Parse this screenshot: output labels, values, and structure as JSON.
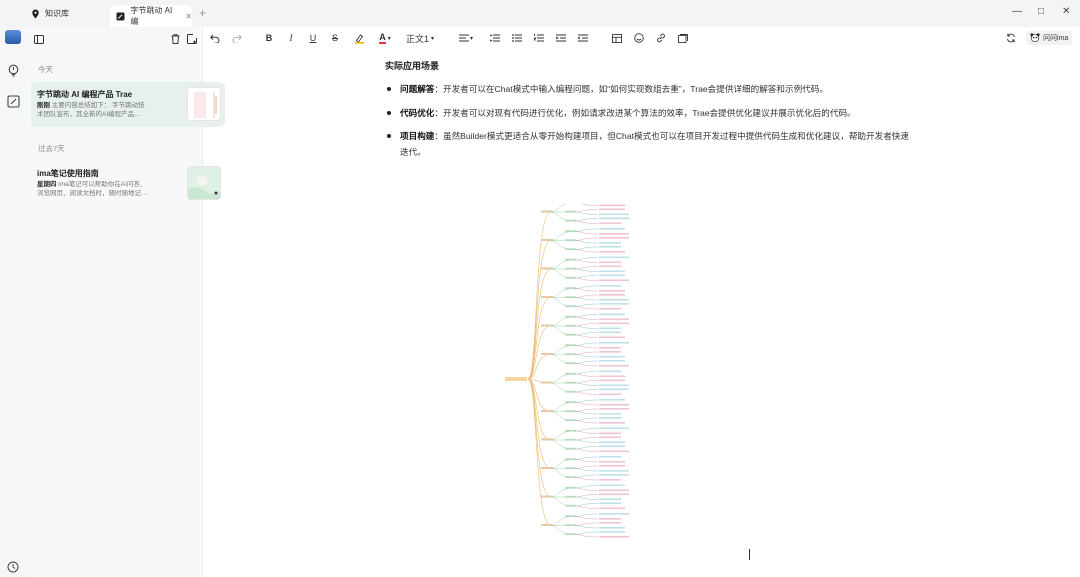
{
  "tabs": [
    {
      "label": "知识库",
      "icon": "pin-icon"
    },
    {
      "label": "字节跳动 AI 编",
      "icon": "note-icon"
    }
  ],
  "window_controls": [
    "—",
    "□",
    "✕"
  ],
  "sidebar": {
    "sections": [
      {
        "label": "今天"
      },
      {
        "label": "过去7天"
      }
    ],
    "notes": [
      {
        "title": "字节跳动 AI 编程产品 Trae",
        "time": "刚刚",
        "line1": " 主要内容总结如下： 字节跳动技",
        "line2": "术团队宣布，其全新的AI编程产品…"
      },
      {
        "title": "ima笔记使用指南",
        "time": "星期四",
        "line1": " ima笔记可以帮助你在AI问答、",
        "line2": "浏览网页、阅读文档时，随时随地记…"
      }
    ]
  },
  "toolbar": {
    "text_style": "正文1",
    "ask_label": "问问ima"
  },
  "doc": {
    "heading": "实际应用场景",
    "bullets": [
      {
        "term": "问题解答",
        "text": "：开发者可以在Chat模式中输入编程问题，如“如何实现数组去重”，Trae会提供详细的解答和示例代码。"
      },
      {
        "term": "代码优化",
        "text": "：开发者可以对现有代码进行优化，例如请求改进某个算法的效率，Trae会提供优化建议并展示优化后的代码。"
      },
      {
        "term": "项目构建",
        "text": "：虽然Builder模式更适合从零开始构建项目，但Chat模式也可以在项目开发过程中提供代码生成和优化建议，帮助开发者快速迭代。"
      }
    ]
  },
  "colors": {
    "accent": "#2e7d5b",
    "mindmap_branch": "#e8b86a",
    "mindmap_leaf": "#6fb6c8",
    "mindmap_leaf2": "#d68ba6"
  }
}
